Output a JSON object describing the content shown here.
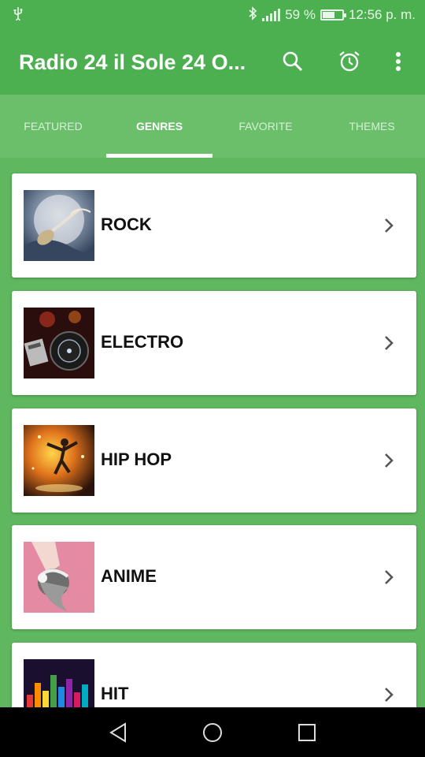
{
  "status_bar": {
    "usb_icon": "usb-icon",
    "bluetooth_icon": "bluetooth-icon",
    "battery_text": "59 %",
    "battery_level": 0.59,
    "time": "12:56 p. m."
  },
  "app_bar": {
    "title": "Radio 24 il Sole 24 O...",
    "icons": [
      "search-icon",
      "alarm-icon",
      "more-vert-icon"
    ]
  },
  "tabs": [
    {
      "label": "FEATURED",
      "active": false
    },
    {
      "label": "GENRES",
      "active": true
    },
    {
      "label": "FAVORITE",
      "active": false
    },
    {
      "label": "THEMES",
      "active": false
    }
  ],
  "genres": [
    {
      "label": "ROCK",
      "thumb_icon": "rock-guitar-image"
    },
    {
      "label": "ELECTRO",
      "thumb_icon": "dj-turntable-image"
    },
    {
      "label": "HIP HOP",
      "thumb_icon": "dancer-image"
    },
    {
      "label": "ANIME",
      "thumb_icon": "anime-girl-headphones-image"
    },
    {
      "label": "HIT",
      "thumb_icon": "equalizer-image"
    }
  ],
  "colors": {
    "primary": "#4caf50",
    "tab_bar": "#6bbf6b",
    "background": "#5fb75f"
  }
}
